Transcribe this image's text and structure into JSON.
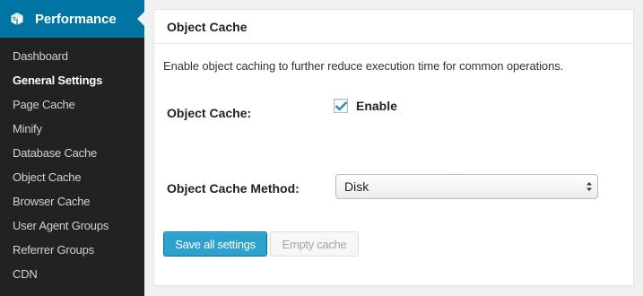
{
  "sidebar": {
    "menu_title": "Performance",
    "menu_icon": "w3tc-cube-icon",
    "items": [
      {
        "label": "Dashboard"
      },
      {
        "label": "General Settings",
        "current": true
      },
      {
        "label": "Page Cache"
      },
      {
        "label": "Minify"
      },
      {
        "label": "Database Cache"
      },
      {
        "label": "Object Cache"
      },
      {
        "label": "Browser Cache"
      },
      {
        "label": "User Agent Groups"
      },
      {
        "label": "Referrer Groups"
      },
      {
        "label": "CDN"
      }
    ]
  },
  "panel": {
    "title": "Object Cache",
    "description": "Enable object caching to further reduce execution time for common operations.",
    "object_cache": {
      "label": "Object Cache:",
      "checkbox_label": "Enable",
      "checked": true
    },
    "method": {
      "label": "Object Cache Method:",
      "selected": "Disk"
    },
    "buttons": {
      "save": "Save all settings",
      "empty": "Empty cache"
    }
  },
  "colors": {
    "accent": "#0074a2",
    "primary_button": "#2ea2cc",
    "sidebar_bg": "#222222",
    "checkmark": "#1e8cbe"
  }
}
